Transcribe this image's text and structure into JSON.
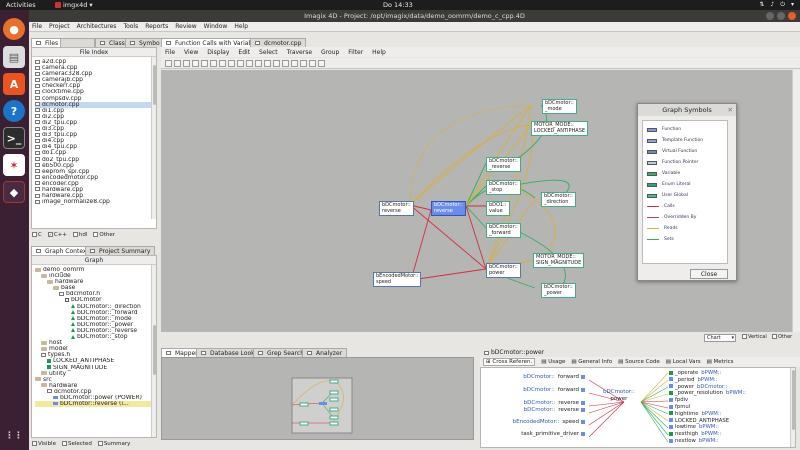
{
  "topbar": {
    "activities": "Activities",
    "app_name": "imgx4d",
    "clock": "Do 14:33"
  },
  "window": {
    "title": "Imagix 4D  -  Project: /opt/imagix/data/demo_oomrm/demo_c_cpp.4D"
  },
  "menu": [
    "File",
    "Project",
    "Architectures",
    "Tools",
    "Reports",
    "Review",
    "Window",
    "Help"
  ],
  "left_tabs": {
    "files": "Files",
    "class": "Class",
    "symbols": "Symbo"
  },
  "file_index": {
    "header": "File Index",
    "files": [
      "a2d.cpp",
      "camera.cpp",
      "camerac328.cpp",
      "camerajb.cpp",
      "checkerr.cpp",
      "clocktime.cpp",
      "compsdv.cpp",
      "dcmotor.cpp",
      "di1.cpp",
      "di2.cpp",
      "di2_tpu.cpp",
      "di3.cpp",
      "di3_tpu.cpp",
      "di4.cpp",
      "di4_tpu.cpp",
      "do1.cpp",
      "do2_tpu.cpp",
      "eb500.cpp",
      "eeprom_spi.cpp",
      "encodedmotor.cpp",
      "encoder.cpp",
      "hardware.cpp",
      "hardware.cpp",
      "image_normalize8.cpp"
    ],
    "selected_index": 7
  },
  "lang_filter": {
    "c": "C",
    "cpp": "C++",
    "hdl": "hdl",
    "other": "Other"
  },
  "context_tabs": {
    "graph_context": "Graph Context",
    "project_summary": "Project Summary"
  },
  "graph_tree": {
    "header": "Graph",
    "items": [
      {
        "t": "demo_oomrm",
        "d": 0,
        "k": "folder"
      },
      {
        "t": "include",
        "d": 1,
        "k": "folder"
      },
      {
        "t": "hardware",
        "d": 2,
        "k": "folder"
      },
      {
        "t": "base",
        "d": 3,
        "k": "folder"
      },
      {
        "t": "bdcmotor.h",
        "d": 4,
        "k": "file"
      },
      {
        "t": "bDCmotor",
        "d": 5,
        "k": "cls"
      },
      {
        "t": "bDCmotor::_direction",
        "d": 6,
        "k": "tri"
      },
      {
        "t": "bDCmotor::_forward",
        "d": 6,
        "k": "tri"
      },
      {
        "t": "bDCmotor::_mode",
        "d": 6,
        "k": "tri"
      },
      {
        "t": "bDCmotor::_power",
        "d": 6,
        "k": "tri"
      },
      {
        "t": "bDCmotor::_reverse",
        "d": 6,
        "k": "tri"
      },
      {
        "t": "bDCmotor::_stop",
        "d": 6,
        "k": "tri"
      },
      {
        "t": "host",
        "d": 1,
        "k": "folder"
      },
      {
        "t": "model",
        "d": 1,
        "k": "folder"
      },
      {
        "t": "types.h",
        "d": 1,
        "k": "file"
      },
      {
        "t": "LOCKED_ANTIPHASE",
        "d": 2,
        "k": "sq"
      },
      {
        "t": "SIGN_MAGNITUDE",
        "d": 2,
        "k": "sq"
      },
      {
        "t": "utility",
        "d": 1,
        "k": "folder"
      },
      {
        "t": "src",
        "d": 0,
        "k": "folder"
      },
      {
        "t": "hardware",
        "d": 1,
        "k": "folder"
      },
      {
        "t": "dcmotor.cpp",
        "d": 2,
        "k": "file"
      },
      {
        "t": "bDCmotor::power (POWER)",
        "d": 3,
        "k": "fn"
      },
      {
        "t": "bDCmotor::reverse (i...",
        "d": 3,
        "k": "fn",
        "sel": true
      }
    ]
  },
  "tree_filter": {
    "visible": "Visible",
    "selected": "Selected",
    "summary": "Summary"
  },
  "graph_tabs": {
    "main": "Function Calls with Variables",
    "file": "dcmotor.cpp"
  },
  "graph_menu": [
    "File",
    "View",
    "Display",
    "Edit",
    "Select",
    "Traverse",
    "Group",
    "Filter",
    "Help"
  ],
  "graph_nodes": [
    {
      "id": "mode",
      "l1": "bDCmotor::",
      "l2": "_mode"
    },
    {
      "id": "locked",
      "l1": "MOTOR_MODE::",
      "l2": "LOCKED_ANTIPHASE"
    },
    {
      "id": "rev_var",
      "l1": "bDCmotor::",
      "l2": "_reverse"
    },
    {
      "id": "stop",
      "l1": "bDCmotor::",
      "l2": "_stop"
    },
    {
      "id": "value",
      "l1": "bDO1::",
      "l2": "value"
    },
    {
      "id": "direction",
      "l1": "bDCmotor::",
      "l2": "_direction"
    },
    {
      "id": "forward",
      "l1": "bDCmotor::",
      "l2": "_forward"
    },
    {
      "id": "rev_left",
      "l1": "bDCmotor::",
      "l2": "reverse"
    },
    {
      "id": "rev_sel",
      "l1": "bDCmotor::",
      "l2": "reverse"
    },
    {
      "id": "speed",
      "l1": "bEncodedMotor::",
      "l2": "speed"
    },
    {
      "id": "power_fn",
      "l1": "bDCmotor::",
      "l2": "power"
    },
    {
      "id": "sign",
      "l1": "MOTOR_MODE::",
      "l2": "SIGN_MAGNITUDE"
    },
    {
      "id": "power_var",
      "l1": "bDCmotor::",
      "l2": "_power"
    }
  ],
  "legend": {
    "title": "Graph Symbols",
    "items": [
      {
        "label": "Function",
        "kind": "box",
        "color": "#7a9ae8"
      },
      {
        "label": "Template Function",
        "kind": "box",
        "color": "#8aa6e0"
      },
      {
        "label": "Virtual Function",
        "kind": "box",
        "color": "#6a88cc"
      },
      {
        "label": "Function Pointer",
        "kind": "box",
        "color": "#b8c8ee"
      },
      {
        "label": "Variable",
        "kind": "box",
        "color": "#2fb26a"
      },
      {
        "label": "Enum Literal",
        "kind": "box",
        "color": "#2fa08a"
      },
      {
        "label": "User Global",
        "kind": "box",
        "color": "#3cc0a0"
      },
      {
        "label": "Calls",
        "kind": "line",
        "color": "#d03040"
      },
      {
        "label": "Overridden By",
        "kind": "line",
        "color": "#b04060"
      },
      {
        "label": "Reads",
        "kind": "line",
        "color": "#d8b040"
      },
      {
        "label": "Sets",
        "kind": "line",
        "color": "#30b060"
      }
    ],
    "close": "Close"
  },
  "chart_select": {
    "value": "Chart",
    "vertical": "Vertical",
    "other": "Other"
  },
  "bottom_tabs": {
    "mapper": "Mapper",
    "db_lookup": "Database Lookup",
    "grep": "Grep Search",
    "analyzer": "Analyzer"
  },
  "xref": {
    "title": "bDCmotor::power",
    "tabs": [
      "Cross Referen.",
      "Usage",
      "General Info",
      "Source Code",
      "Local Vars",
      "Metrics"
    ],
    "left": [
      {
        "a": "bDCmotor::",
        "b": "forward"
      },
      {
        "a": "bDCmotor::",
        "b": "forward"
      },
      {
        "a": "bDCmotor::",
        "b": "reverse"
      },
      {
        "a": "bDCmotor::",
        "b": "reverse"
      },
      {
        "a": "bEncodedMotor::",
        "b": "speed"
      },
      {
        "a": "",
        "b": "task_primitive_driver"
      }
    ],
    "center_a": "bDCmotor::",
    "center_b": "power",
    "right": [
      {
        "a": "_operate",
        "b": "bPWM::"
      },
      {
        "a": "_period",
        "b": "bPWM::"
      },
      {
        "a": "_power",
        "b": "bDCmotor::"
      },
      {
        "a": "_power_resolution",
        "b": "bPWM::"
      },
      {
        "a": "fpdiv",
        "b": ""
      },
      {
        "a": "fpmul",
        "b": ""
      },
      {
        "a": "hightime",
        "b": "bPWM::"
      },
      {
        "a": "LOCKED_ANTIPHASE",
        "b": ""
      },
      {
        "a": "lowtime",
        "b": "bPWM::"
      },
      {
        "a": "nexthigh",
        "b": "bPWM::"
      },
      {
        "a": "nextlow",
        "b": "bPWM::"
      }
    ]
  }
}
